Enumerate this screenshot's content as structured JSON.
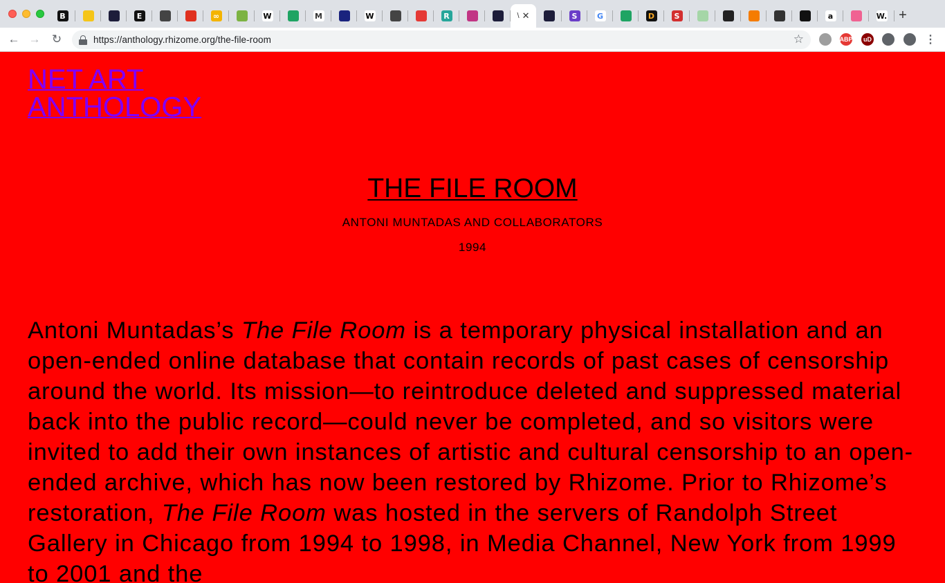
{
  "browser": {
    "url": "https://anthology.rhizome.org/the-file-room",
    "active_tab_title": "\\",
    "tabs": [
      {
        "icon": "B",
        "bg": "#111111",
        "fg": "#ffffff"
      },
      {
        "icon": "",
        "bg": "#f5c518",
        "fg": "#ffffff"
      },
      {
        "icon": "",
        "bg": "#1d1d3a",
        "fg": "#ffffff"
      },
      {
        "icon": "E",
        "bg": "#111111",
        "fg": "#ffffff"
      },
      {
        "icon": "",
        "bg": "#444444",
        "fg": "#ffffff"
      },
      {
        "icon": "",
        "bg": "#e0301e",
        "fg": "#ffffff"
      },
      {
        "icon": "∞",
        "bg": "#f4b400",
        "fg": "#ffffff"
      },
      {
        "icon": "",
        "bg": "#7cb342",
        "fg": "#ffffff"
      },
      {
        "icon": "W",
        "bg": "#ffffff",
        "fg": "#000000"
      },
      {
        "icon": "",
        "bg": "#1fa463",
        "fg": "#ffffff"
      },
      {
        "icon": "M",
        "bg": "#ffffff",
        "fg": "#333333"
      },
      {
        "icon": "",
        "bg": "#1a237e",
        "fg": "#ffffff"
      },
      {
        "icon": "W",
        "bg": "#ffffff",
        "fg": "#000000"
      },
      {
        "icon": "",
        "bg": "#444444",
        "fg": "#ffffff"
      },
      {
        "icon": "",
        "bg": "#e53935",
        "fg": "#ffffff"
      },
      {
        "icon": "R",
        "bg": "#26a69a",
        "fg": "#ffffff"
      },
      {
        "icon": "",
        "bg": "#c13584",
        "fg": "#ffffff"
      },
      {
        "icon": "",
        "bg": "#1d1d3a",
        "fg": "#ffffff"
      },
      {
        "icon": "",
        "bg": "#1d1d3a",
        "fg": "#ffffff"
      },
      {
        "icon": "S",
        "bg": "#6a3dc8",
        "fg": "#ffffff"
      },
      {
        "icon": "G",
        "bg": "#ffffff",
        "fg": "#4285f4"
      },
      {
        "icon": "",
        "bg": "#1fa463",
        "fg": "#ffffff"
      },
      {
        "icon": "D",
        "bg": "#111111",
        "fg": "#f5a623"
      },
      {
        "icon": "S",
        "bg": "#d32f2f",
        "fg": "#ffffff"
      },
      {
        "icon": "",
        "bg": "#a5d6a7",
        "fg": "#ffffff"
      },
      {
        "icon": "",
        "bg": "#222222",
        "fg": "#ffeb3b"
      },
      {
        "icon": "",
        "bg": "#f57c00",
        "fg": "#ffffff"
      },
      {
        "icon": "",
        "bg": "#333333",
        "fg": "#ffffff"
      },
      {
        "icon": "",
        "bg": "#111111",
        "fg": "#ffffff"
      },
      {
        "icon": "a",
        "bg": "#ffffff",
        "fg": "#111111"
      },
      {
        "icon": "",
        "bg": "#f06292",
        "fg": "#ffffff"
      },
      {
        "icon": "W.",
        "bg": "#ffffff",
        "fg": "#111111"
      }
    ],
    "extensions": [
      {
        "label": "",
        "bg": "#9e9e9e"
      },
      {
        "label": "ABP",
        "bg": "#e53935"
      },
      {
        "label": "uD",
        "bg": "#8b0000"
      },
      {
        "label": "",
        "bg": "#5f6368"
      },
      {
        "label": "",
        "bg": "#5f6368"
      },
      {
        "label": "⋮",
        "bg": "#ffffff"
      }
    ]
  },
  "site": {
    "logo_line1": "NET ART",
    "logo_line2": "ANTHOLOGY"
  },
  "artwork": {
    "title": "THE FILE ROOM",
    "artist": "ANTONI MUNTADAS AND COLLABORATORS",
    "year": "1994"
  },
  "essay": {
    "p1_a": "Antoni Muntadas’s ",
    "p1_title1": "The File Room",
    "p1_b": " is a temporary physical installation and an open-ended online database that contain records of past cases of censorship around the world. Its mission—to reintroduce deleted and suppressed material back into the public record—could never be completed, and so visitors were invited to add their own instances of artistic and cultural censorship to an open-ended archive, which has now been restored by Rhizome. Prior to Rhizome’s restoration, ",
    "p1_title2": "The File Room",
    "p1_c": " was hosted in the servers of Randolph Street Gallery in Chicago from 1994 to 1998, in Media Channel, New York from 1999 to 2001 and the"
  },
  "colors": {
    "page_bg": "#ff0000",
    "logo_link": "#8000ff",
    "text": "#000000"
  }
}
